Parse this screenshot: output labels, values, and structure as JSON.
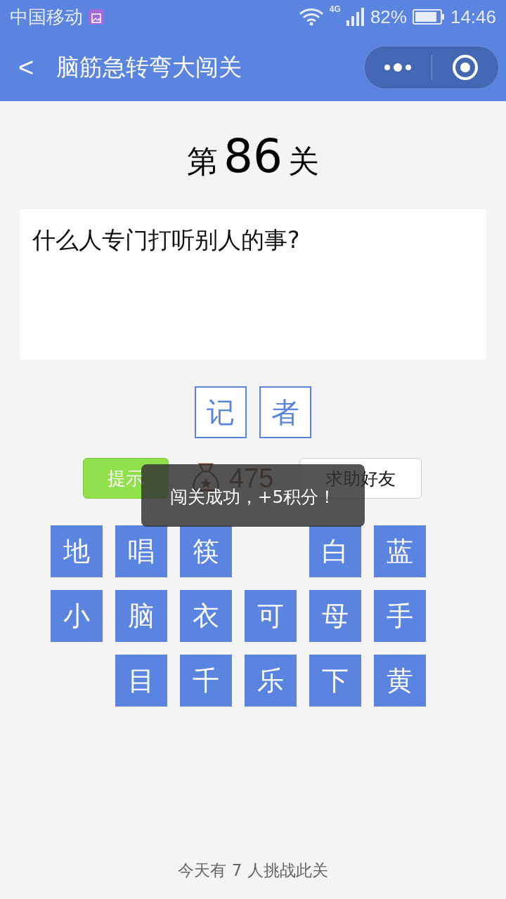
{
  "status_bar": {
    "carrier": "中国移动",
    "network": "4G",
    "battery": "82%",
    "time": "14:46"
  },
  "nav_bar": {
    "back": "<",
    "title": "脑筋急转弯大闯关"
  },
  "level": {
    "prefix": "第",
    "number": "86",
    "suffix": "关"
  },
  "question": "什么人专门打听别人的事?",
  "answer": [
    "记",
    "者"
  ],
  "actions": {
    "hint": "提示",
    "coins": "475",
    "help": "求助好友"
  },
  "toast": "闯关成功，+5积分！",
  "tiles": [
    {
      "kind": "letter",
      "text": "地"
    },
    {
      "kind": "letter",
      "text": "唱"
    },
    {
      "kind": "letter",
      "text": "筷"
    },
    {
      "kind": "blank"
    },
    {
      "kind": "letter",
      "text": "白"
    },
    {
      "kind": "letter",
      "text": "蓝"
    },
    {
      "kind": "letter",
      "text": "小"
    },
    {
      "kind": "letter",
      "text": "脑"
    },
    {
      "kind": "letter",
      "text": "衣"
    },
    {
      "kind": "letter",
      "text": "可"
    },
    {
      "kind": "letter",
      "text": "母"
    },
    {
      "kind": "letter",
      "text": "手"
    },
    {
      "kind": "blank"
    },
    {
      "kind": "letter",
      "text": "目"
    },
    {
      "kind": "letter",
      "text": "千"
    },
    {
      "kind": "letter",
      "text": "乐"
    },
    {
      "kind": "letter",
      "text": "下"
    },
    {
      "kind": "letter",
      "text": "黄"
    }
  ],
  "footer": "今天有 7 人挑战此关"
}
